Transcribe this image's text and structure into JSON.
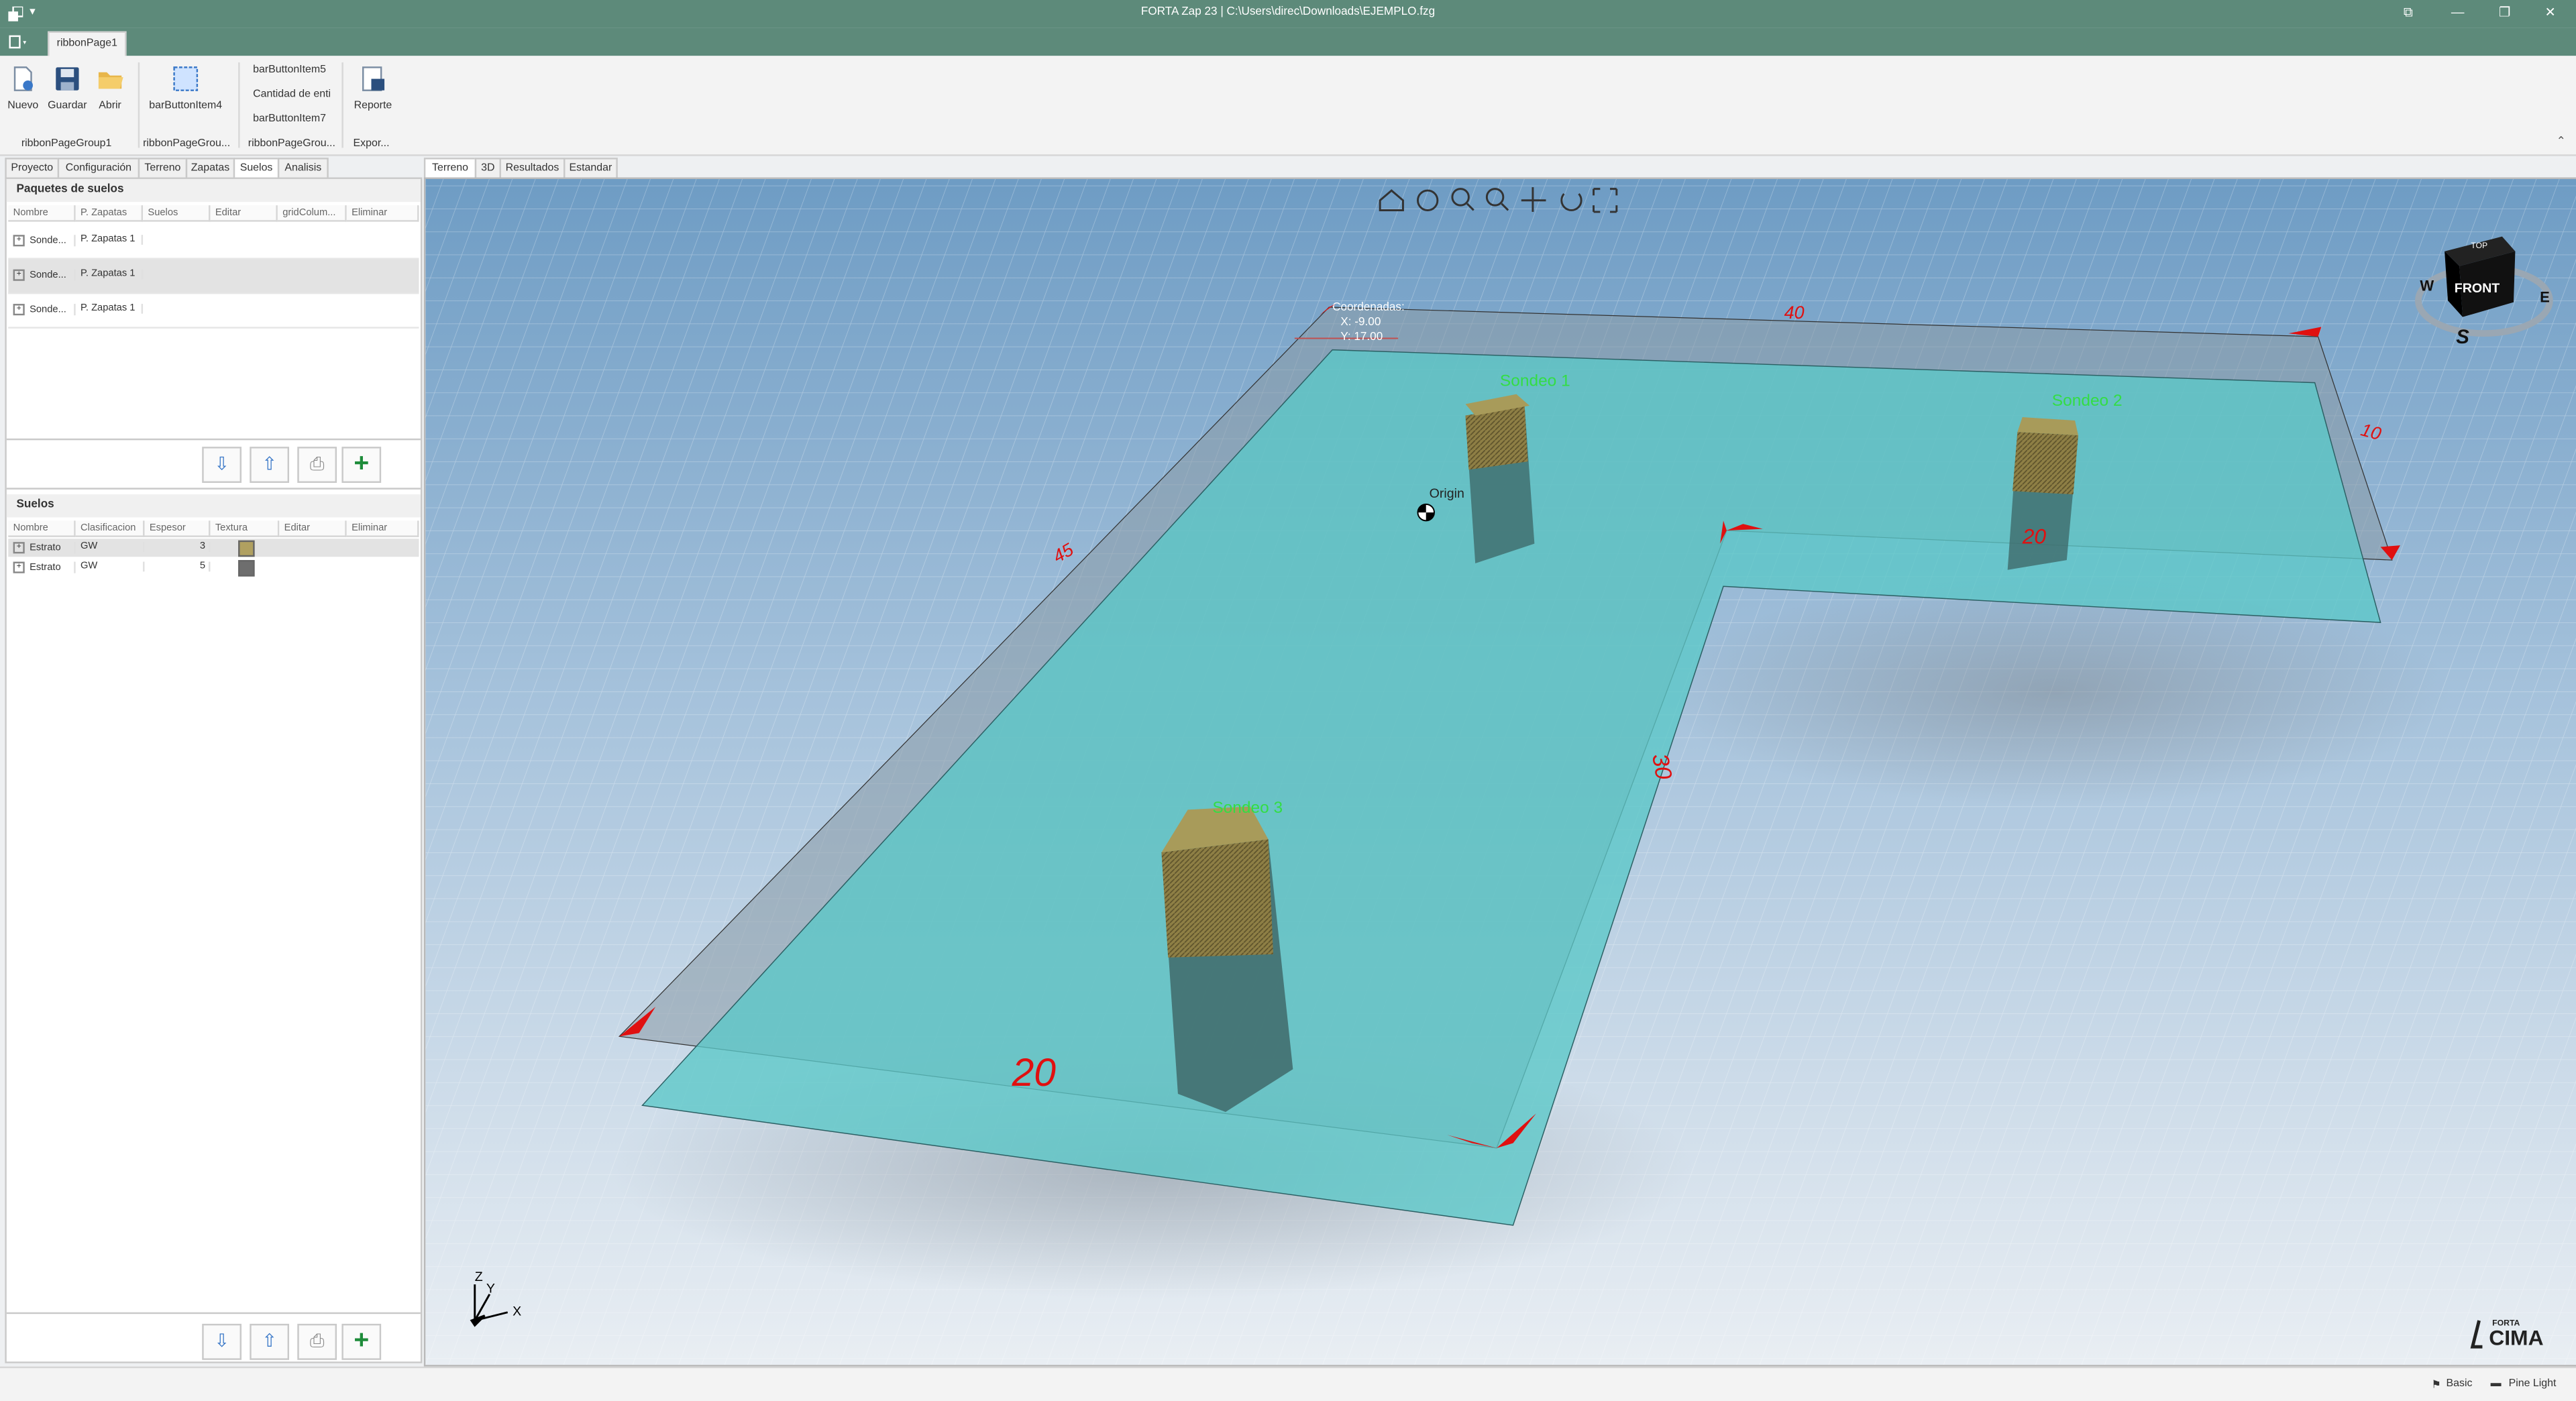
{
  "window": {
    "title": "FORTA Zap 23 | C:\\Users\\direc\\Downloads\\EJEMPLO.fzg",
    "quick_access": "▾"
  },
  "ribbon": {
    "tab": "ribbonPage1",
    "buttons": {
      "nuevo": "Nuevo",
      "guardar": "Guardar",
      "abrir": "Abrir",
      "bar4": "barButtonItem4",
      "bar5": "barButtonItem5",
      "cantidad": "Cantidad de enti",
      "bar7": "barButtonItem7",
      "reporte": "Reporte"
    },
    "groups": {
      "g1": "ribbonPageGroup1",
      "g2": "ribbonPageGrou...",
      "g3": "ribbonPageGrou...",
      "g4": "Expor..."
    }
  },
  "left_tabs": [
    "Proyecto",
    "Configuración",
    "Terreno",
    "Zapatas",
    "Suelos",
    "Analisis"
  ],
  "paquetes": {
    "title": "Paquetes de suelos",
    "columns": [
      "Nombre",
      "P. Zapatas",
      "Suelos",
      "Editar",
      "gridColum...",
      "Eliminar"
    ],
    "rows": [
      {
        "nombre": "Sonde...",
        "pzapatas": "P. Zapatas 1"
      },
      {
        "nombre": "Sonde...",
        "pzapatas": "P. Zapatas 1"
      },
      {
        "nombre": "Sonde...",
        "pzapatas": "P. Zapatas 1"
      }
    ]
  },
  "suelos": {
    "title": "Suelos",
    "columns": [
      "Nombre",
      "Clasificacion",
      "Espesor",
      "Textura",
      "Editar",
      "Eliminar"
    ],
    "rows": [
      {
        "nombre": "Estrato",
        "clasificacion": "GW",
        "espesor": "3",
        "color": "#b0a060"
      },
      {
        "nombre": "Estrato",
        "clasificacion": "GW",
        "espesor": "5",
        "color": "#6e6e6e"
      }
    ]
  },
  "view_tabs": [
    "Terreno",
    "3D",
    "Resultados",
    "Estandar"
  ],
  "scene": {
    "coords_label": "Coordenadas:",
    "coord_x": "X: -9.00",
    "coord_y": "Y: 17.00",
    "origin": "Origin",
    "sondeo1": "Sondeo 1",
    "sondeo2": "Sondeo 2",
    "sondeo3": "Sondeo 3",
    "dim_top": "40",
    "dim_left": "45",
    "dim_right": "10",
    "dim_inner": "20",
    "dim_mid": "30",
    "dim_bottom": "20",
    "cube_top": "TOP",
    "cube_front": "FRONT",
    "cube_w": "W",
    "cube_e": "E",
    "cube_s": "S",
    "axis_z": "Z",
    "axis_y": "Y",
    "axis_x": "X",
    "logo_small": "FORTA",
    "logo": "CIMA"
  },
  "status": {
    "basic": "Basic",
    "theme": "Pine Light"
  },
  "colors": {
    "titlebar": "#5d8a7a",
    "slab": "#5bc8c8",
    "dimension": "#e01010",
    "label_green": "#33dd44"
  }
}
